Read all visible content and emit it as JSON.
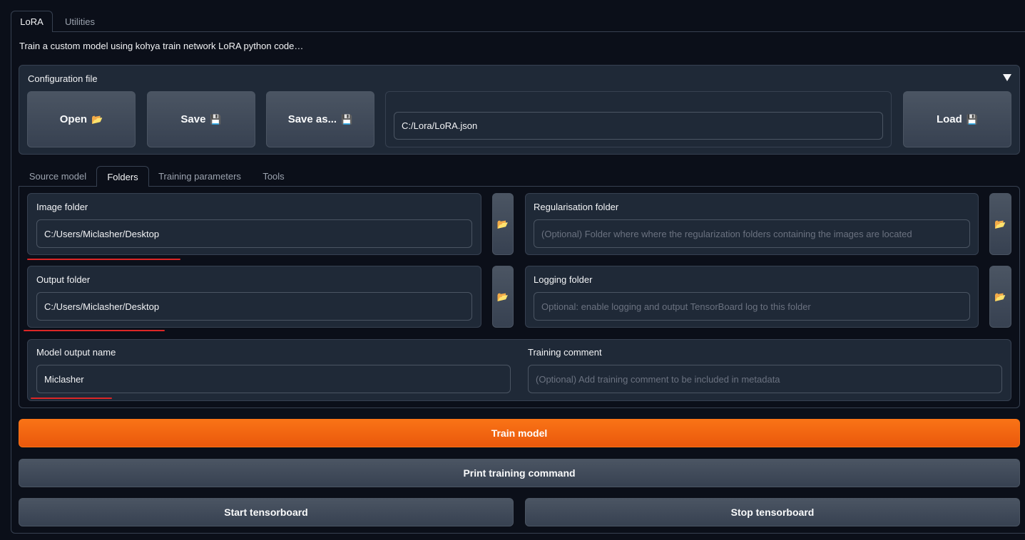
{
  "top_tabs": [
    {
      "label": "LoRA",
      "active": true
    },
    {
      "label": "Utilities",
      "active": false
    }
  ],
  "description": "Train a custom model using kohya train network LoRA python code…",
  "config": {
    "label": "Configuration file",
    "open_label": "Open",
    "save_label": "Save",
    "save_as_label": "Save as...",
    "file_path": "C:/Lora/LoRA.json",
    "load_label": "Load",
    "folder_icon": "📂",
    "disk_icon": "💾"
  },
  "sub_tabs": [
    {
      "label": "Source model",
      "active": false
    },
    {
      "label": "Folders",
      "active": true
    },
    {
      "label": "Training parameters",
      "active": false
    },
    {
      "label": "Tools",
      "active": false
    }
  ],
  "folders": {
    "image_folder": {
      "label": "Image folder",
      "value": "C:/Users/Miclasher/Desktop"
    },
    "reg_folder": {
      "label": "Regularisation folder",
      "placeholder": "(Optional) Folder where where the regularization folders containing the images are located"
    },
    "output_folder": {
      "label": "Output folder",
      "value": "C:/Users/Miclasher/Desktop"
    },
    "logging_folder": {
      "label": "Logging folder",
      "placeholder": "Optional: enable logging and output TensorBoard log to this folder"
    },
    "model_output_name": {
      "label": "Model output name",
      "value": "Miclasher"
    },
    "training_comment": {
      "label": "Training comment",
      "placeholder": "(Optional) Add training comment to be included in metadata"
    },
    "folder_icon": "📂"
  },
  "actions": {
    "train": "Train model",
    "print_command": "Print training command",
    "start_tensorboard": "Start tensorboard",
    "stop_tensorboard": "Stop tensorboard"
  },
  "colors": {
    "background": "#0b0f19",
    "panel": "#1f2937",
    "accent": "#f97316",
    "annotation": "#dc2626"
  }
}
